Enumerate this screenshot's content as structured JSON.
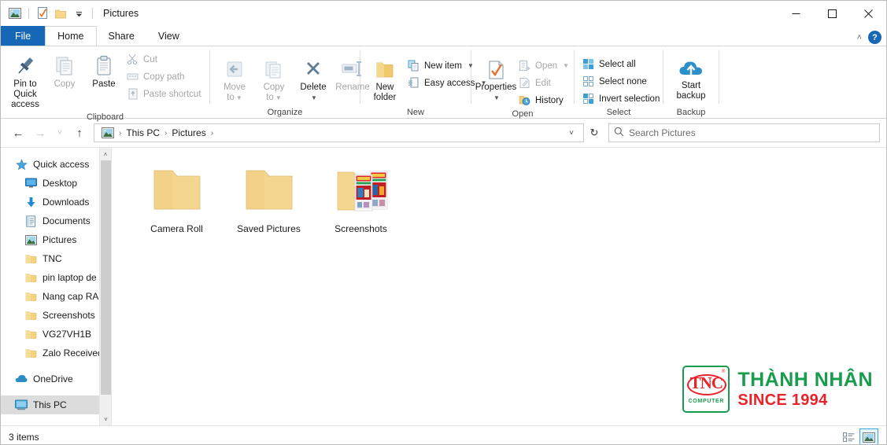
{
  "window": {
    "title": "Pictures",
    "quick_access_toolbar": [
      {
        "name": "pictures-icon",
        "label": "Pictures"
      },
      {
        "name": "properties-icon",
        "label": "Properties"
      },
      {
        "name": "new-folder-icon",
        "label": "New folder"
      },
      {
        "name": "customize-dropdown-icon",
        "label": "Customize Quick Access Toolbar"
      }
    ],
    "controls": {
      "minimize": "—",
      "maximize": "□",
      "close": "✕"
    }
  },
  "tabs": [
    {
      "label": "File",
      "active": false,
      "is_file": true
    },
    {
      "label": "Home",
      "active": true,
      "is_file": false
    },
    {
      "label": "Share",
      "active": false,
      "is_file": false
    },
    {
      "label": "View",
      "active": false,
      "is_file": false
    }
  ],
  "ribbon": {
    "collapse_label": "˄",
    "help_label": "?",
    "groups": [
      {
        "label": "Clipboard",
        "big_buttons": [
          {
            "label_line1": "Pin to Quick",
            "label_line2": "access",
            "icon": "pin-icon",
            "disabled": false
          },
          {
            "label_line1": "Copy",
            "label_line2": "",
            "icon": "copy-icon",
            "disabled": true
          },
          {
            "label_line1": "Paste",
            "label_line2": "",
            "icon": "paste-icon",
            "disabled": false
          }
        ],
        "small_buttons": [
          {
            "label": "Cut",
            "icon": "scissors-icon",
            "disabled": true
          },
          {
            "label": "Copy path",
            "icon": "copy-path-icon",
            "disabled": true
          },
          {
            "label": "Paste shortcut",
            "icon": "paste-shortcut-icon",
            "disabled": true
          }
        ]
      },
      {
        "label": "Organize",
        "big_buttons": [
          {
            "label_line1": "Move",
            "label_line2": "to",
            "icon": "move-to-icon",
            "disabled": true,
            "caret": true
          },
          {
            "label_line1": "Copy",
            "label_line2": "to",
            "icon": "copy-to-icon",
            "disabled": true,
            "caret": true
          },
          {
            "label_line1": "Delete",
            "label_line2": "",
            "icon": "delete-icon",
            "disabled": false,
            "caret_below": true
          },
          {
            "label_line1": "Rename",
            "label_line2": "",
            "icon": "rename-icon",
            "disabled": true
          }
        ],
        "small_buttons": []
      },
      {
        "label": "New",
        "big_buttons": [
          {
            "label_line1": "New",
            "label_line2": "folder",
            "icon": "new-folder-icon",
            "disabled": false
          }
        ],
        "small_buttons": [
          {
            "label": "New item",
            "icon": "new-item-icon",
            "disabled": false,
            "caret": true
          },
          {
            "label": "Easy access",
            "icon": "easy-access-icon",
            "disabled": false,
            "caret": true
          }
        ]
      },
      {
        "label": "Open",
        "big_buttons": [
          {
            "label_line1": "Properties",
            "label_line2": "",
            "icon": "properties-icon",
            "disabled": false,
            "caret_below": true
          }
        ],
        "small_buttons": [
          {
            "label": "Open",
            "icon": "open-icon",
            "disabled": true,
            "caret": true
          },
          {
            "label": "Edit",
            "icon": "edit-icon",
            "disabled": true
          },
          {
            "label": "History",
            "icon": "history-icon",
            "disabled": false
          }
        ]
      },
      {
        "label": "Select",
        "big_buttons": [],
        "small_buttons": [
          {
            "label": "Select all",
            "icon": "select-all-icon",
            "disabled": false
          },
          {
            "label": "Select none",
            "icon": "select-none-icon",
            "disabled": false
          },
          {
            "label": "Invert selection",
            "icon": "invert-selection-icon",
            "disabled": false
          }
        ]
      },
      {
        "label": "Backup",
        "big_buttons": [
          {
            "label_line1": "Start",
            "label_line2": "backup",
            "icon": "cloud-upload-icon",
            "disabled": false
          }
        ],
        "small_buttons": []
      }
    ]
  },
  "addressbar": {
    "back_icon": "←",
    "forward_icon": "→",
    "recent_icon": "˅",
    "up_icon": "↑",
    "breadcrumb": [
      {
        "label": "This PC"
      },
      {
        "label": "Pictures"
      }
    ],
    "breadcrumb_separator": "›",
    "dropdown_icon": "˅",
    "refresh_icon": "↻",
    "search_placeholder": "Search Pictures"
  },
  "sidebar": {
    "items": [
      {
        "label": "Quick access",
        "icon": "star-icon",
        "level": 1,
        "pinned": false,
        "selected": false
      },
      {
        "label": "Desktop",
        "icon": "desktop-icon",
        "level": 2,
        "pinned": true,
        "selected": false
      },
      {
        "label": "Downloads",
        "icon": "download-icon",
        "level": 2,
        "pinned": true,
        "selected": false
      },
      {
        "label": "Documents",
        "icon": "documents-icon",
        "level": 2,
        "pinned": true,
        "selected": false
      },
      {
        "label": "Pictures",
        "icon": "pictures-icon",
        "level": 2,
        "pinned": true,
        "selected": false
      },
      {
        "label": "TNC",
        "icon": "folder-icon",
        "level": 2,
        "pinned": true,
        "selected": false
      },
      {
        "label": "pin laptop de",
        "icon": "folder-icon",
        "level": 2,
        "pinned": true,
        "selected": false
      },
      {
        "label": "Nang cap RAM",
        "icon": "folder-icon",
        "level": 2,
        "pinned": false,
        "selected": false
      },
      {
        "label": "Screenshots",
        "icon": "folder-icon",
        "level": 2,
        "pinned": false,
        "selected": false
      },
      {
        "label": "VG27VH1B",
        "icon": "folder-icon",
        "level": 2,
        "pinned": false,
        "selected": false
      },
      {
        "label": "Zalo Received Fi",
        "icon": "folder-icon",
        "level": 2,
        "pinned": false,
        "selected": false
      },
      {
        "label": "OneDrive",
        "icon": "cloud-icon",
        "level": 1,
        "pinned": false,
        "selected": false
      },
      {
        "label": "This PC",
        "icon": "this-pc-icon",
        "level": 1,
        "pinned": false,
        "selected": true
      }
    ],
    "scroll_up_icon": "˄",
    "scroll_down_icon": "˅"
  },
  "content": {
    "files": [
      {
        "name": "Camera Roll",
        "type": "folder",
        "has_preview": false
      },
      {
        "name": "Saved Pictures",
        "type": "folder",
        "has_preview": false
      },
      {
        "name": "Screenshots",
        "type": "folder",
        "has_preview": true
      }
    ]
  },
  "watermark": {
    "logo_text": "TNC",
    "logo_sub": "COMPUTER",
    "registered": "®",
    "line1": "THÀNH NHÂN",
    "line2": "SINCE 1994",
    "green": "#1a9c4e",
    "red": "#e8232a"
  },
  "statusbar": {
    "item_count": "3 items",
    "views": [
      {
        "name": "details-view-button",
        "active": false
      },
      {
        "name": "large-icons-view-button",
        "active": true
      }
    ]
  },
  "colors": {
    "accent_blue": "#1667b5",
    "folder_yellow": "#f5d07a",
    "selected_gray": "#dcdcdc"
  }
}
